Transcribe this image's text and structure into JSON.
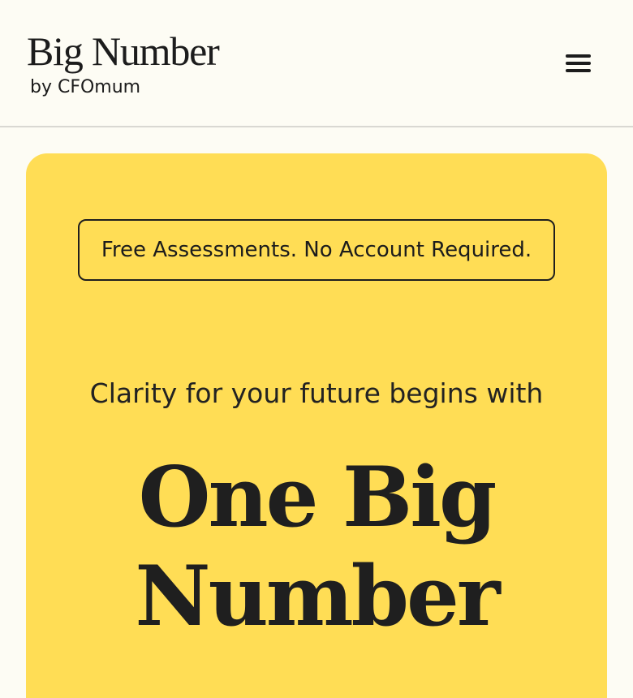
{
  "header": {
    "brand_title": "Big Number",
    "brand_subtitle": "by CFOmum",
    "menu_icon": "hamburger-menu-icon"
  },
  "hero": {
    "background_color": "#ffdd55",
    "badge_text": "Free Assessments. No Account Required.",
    "tagline": "Clarity for your future begins with",
    "headline_line1": "One Big",
    "headline_line2": "Number"
  }
}
